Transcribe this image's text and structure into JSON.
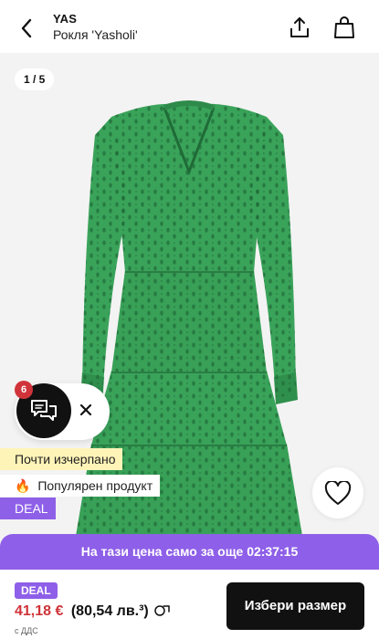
{
  "header": {
    "brand": "YAS",
    "product_title": "Рокля 'Yasholi'",
    "icons": [
      "chevron-left-icon",
      "share-icon",
      "shopping-bag-icon"
    ]
  },
  "gallery": {
    "counter": "1 / 5",
    "dress_color": "#3aa35a"
  },
  "chat": {
    "badge_count": "6",
    "icons": [
      "chat-bubbles-icon",
      "close-icon"
    ]
  },
  "tags": {
    "low_stock": "Почти изчерпано",
    "popular_emoji": "🔥",
    "popular": "Популярен продукт",
    "deal": "DEAL"
  },
  "promo": {
    "timer_text": "На тази цена само за още 02:37:15"
  },
  "purchase": {
    "deal_badge": "DEAL",
    "price": "41,18 €",
    "price_alt": "(80,54 лв.³)",
    "vat_note": "с ДДС",
    "select_size_label": "Избери размер"
  },
  "colors": {
    "accent_purple": "#8e5fe8",
    "price_red": "#d0343a",
    "low_stock_bg": "#fff4b8"
  }
}
